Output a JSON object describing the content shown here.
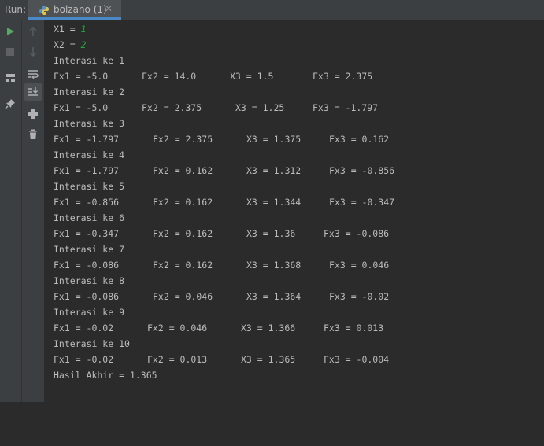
{
  "tabbar": {
    "run_label": "Run:",
    "tab_title": "bolzano (1)",
    "close_glyph": "✕"
  },
  "colors": {
    "accent": "#4a88c7",
    "run_green": "#59a869",
    "input_green": "#24a33b",
    "text": "#bbbbbb",
    "background": "#2b2b2b"
  },
  "toolbar": {
    "icons": [
      "run-icon",
      "stop-icon",
      "layout-icon",
      "pin-icon",
      "up-arrow-icon",
      "down-arrow-icon",
      "soft-wrap-icon",
      "scroll-to-end-icon",
      "print-icon",
      "trash-icon"
    ]
  },
  "console": {
    "x1_prefix": "X1 = ",
    "x1_input": "1",
    "x2_prefix": "X2 = ",
    "x2_input": "2",
    "iterations": [
      {
        "header": "Interasi ke 1",
        "fx1": "Fx1 = -5.0",
        "fx2": "Fx2 = 14.0",
        "x3": "X3 = 1.5",
        "fx3": "Fx3 = 2.375"
      },
      {
        "header": "Interasi ke 2",
        "fx1": "Fx1 = -5.0",
        "fx2": "Fx2 = 2.375",
        "x3": "X3 = 1.25",
        "fx3": "Fx3 = -1.797"
      },
      {
        "header": "Interasi ke 3",
        "fx1": "Fx1 = -1.797",
        "fx2": "Fx2 = 2.375",
        "x3": "X3 = 1.375",
        "fx3": "Fx3 = 0.162"
      },
      {
        "header": "Interasi ke 4",
        "fx1": "Fx1 = -1.797",
        "fx2": "Fx2 = 0.162",
        "x3": "X3 = 1.312",
        "fx3": "Fx3 = -0.856"
      },
      {
        "header": "Interasi ke 5",
        "fx1": "Fx1 = -0.856",
        "fx2": "Fx2 = 0.162",
        "x3": "X3 = 1.344",
        "fx3": "Fx3 = -0.347"
      },
      {
        "header": "Interasi ke 6",
        "fx1": "Fx1 = -0.347",
        "fx2": "Fx2 = 0.162",
        "x3": "X3 = 1.36",
        "fx3": "Fx3 = -0.086"
      },
      {
        "header": "Interasi ke 7",
        "fx1": "Fx1 = -0.086",
        "fx2": "Fx2 = 0.162",
        "x3": "X3 = 1.368",
        "fx3": "Fx3 = 0.046"
      },
      {
        "header": "Interasi ke 8",
        "fx1": "Fx1 = -0.086",
        "fx2": "Fx2 = 0.046",
        "x3": "X3 = 1.364",
        "fx3": "Fx3 = -0.02"
      },
      {
        "header": "Interasi ke 9",
        "fx1": "Fx1 = -0.02",
        "fx2": "Fx2 = 0.046",
        "x3": "X3 = 1.366",
        "fx3": "Fx3 = 0.013"
      },
      {
        "header": "Interasi ke 10",
        "fx1": "Fx1 = -0.02",
        "fx2": "Fx2 = 0.013",
        "x3": "X3 = 1.365",
        "fx3": "Fx3 = -0.004"
      }
    ],
    "result": "Hasil Akhir = 1.365"
  }
}
